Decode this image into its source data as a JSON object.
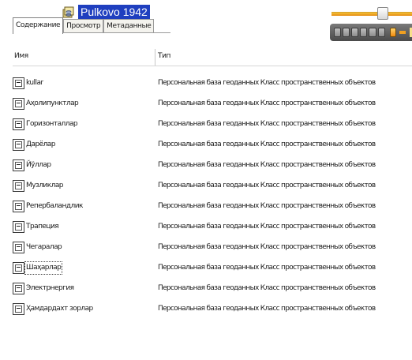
{
  "window": {
    "title": "Pulkovo 1942",
    "title_icon": "geodatabase-icon"
  },
  "tabs": [
    {
      "label": "Содержание",
      "active": true
    },
    {
      "label": "Просмотр",
      "active": false
    },
    {
      "label": "Метаданные",
      "active": false
    }
  ],
  "columns": {
    "name": "Имя",
    "type": "Тип"
  },
  "rows": [
    {
      "name": "kullar",
      "type": "Персональная база геоданных Класс пространственных объектов",
      "icon": "line-feature-class-icon"
    },
    {
      "name": "Аҳолипунктлар",
      "type": "Персональная база геоданных Класс пространственных объектов",
      "icon": "polygon-feature-class-icon"
    },
    {
      "name": "Горизонталлар",
      "type": "Персональная база геоданных Класс пространственных объектов",
      "icon": "line-feature-class-icon"
    },
    {
      "name": "Дарёлар",
      "type": "Персональная база геоданных Класс пространственных объектов",
      "icon": "line-feature-class-icon"
    },
    {
      "name": "Йўллар",
      "type": "Персональная база геоданных Класс пространственных объектов",
      "icon": "line-feature-class-icon"
    },
    {
      "name": "Музликлар",
      "type": "Персональная база геоданных Класс пространственных объектов",
      "icon": "polygon-feature-class-icon"
    },
    {
      "name": "Репербаландлик",
      "type": "Персональная база геоданных Класс пространственных объектов",
      "icon": "point-feature-class-icon"
    },
    {
      "name": "Трапеция",
      "type": "Персональная база геоданных Класс пространственных объектов",
      "icon": "line-feature-class-icon"
    },
    {
      "name": "Чегаралар",
      "type": "Персональная база геоданных Класс пространственных объектов",
      "icon": "line-feature-class-icon"
    },
    {
      "name": "Шаҳарлар",
      "type": "Персональная база геоданных Класс пространственных объектов",
      "icon": "point-feature-class-icon",
      "focused": true
    },
    {
      "name": "Электрнергия",
      "type": "Персональная база геоданных Класс пространственных объектов",
      "icon": "line-feature-class-icon"
    },
    {
      "name": "Ҳамдардахт зорлар",
      "type": "Персональная база геоданных Класс пространственных объектов",
      "icon": "polygon-feature-class-icon"
    }
  ],
  "colors": {
    "title_highlight": "#1f3fbf",
    "slider_fill": "#f0a020"
  }
}
